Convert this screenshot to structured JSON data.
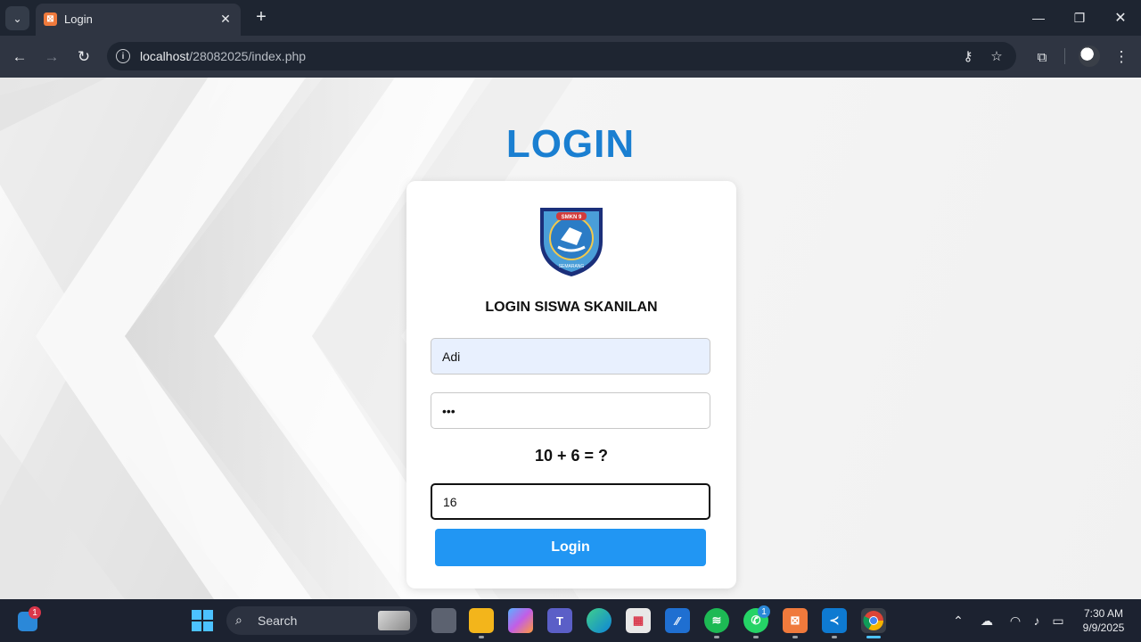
{
  "browser": {
    "tab_title": "Login",
    "tab_favicon": "xampp-icon",
    "url_host": "localhost",
    "url_path": "/28082025/index.php"
  },
  "page": {
    "title": "LOGIN",
    "subtitle": "LOGIN SISWA SKANILAN",
    "logo": "smkn-9-semarang-emblem",
    "logo_text_top": "SMKN 9",
    "logo_text_bottom": "SEMARANG",
    "username_value": "Adi",
    "password_value": "•••",
    "captcha_question": "10 + 6 = ?",
    "captcha_answer": "16",
    "login_button": "Login",
    "accent_color": "#1a7fd1",
    "button_color": "#2196f3"
  },
  "taskbar": {
    "search_label": "Search",
    "widgets_badge": "1",
    "whatsapp_badge": "1",
    "time": "7:30 AM",
    "date": "9/9/2025",
    "pinned": [
      "start",
      "search",
      "task-view",
      "file-explorer",
      "copilot",
      "teams",
      "edge",
      "microsoft-store",
      "ms-app",
      "spotify",
      "whatsapp",
      "xampp",
      "vscode",
      "chrome"
    ]
  }
}
